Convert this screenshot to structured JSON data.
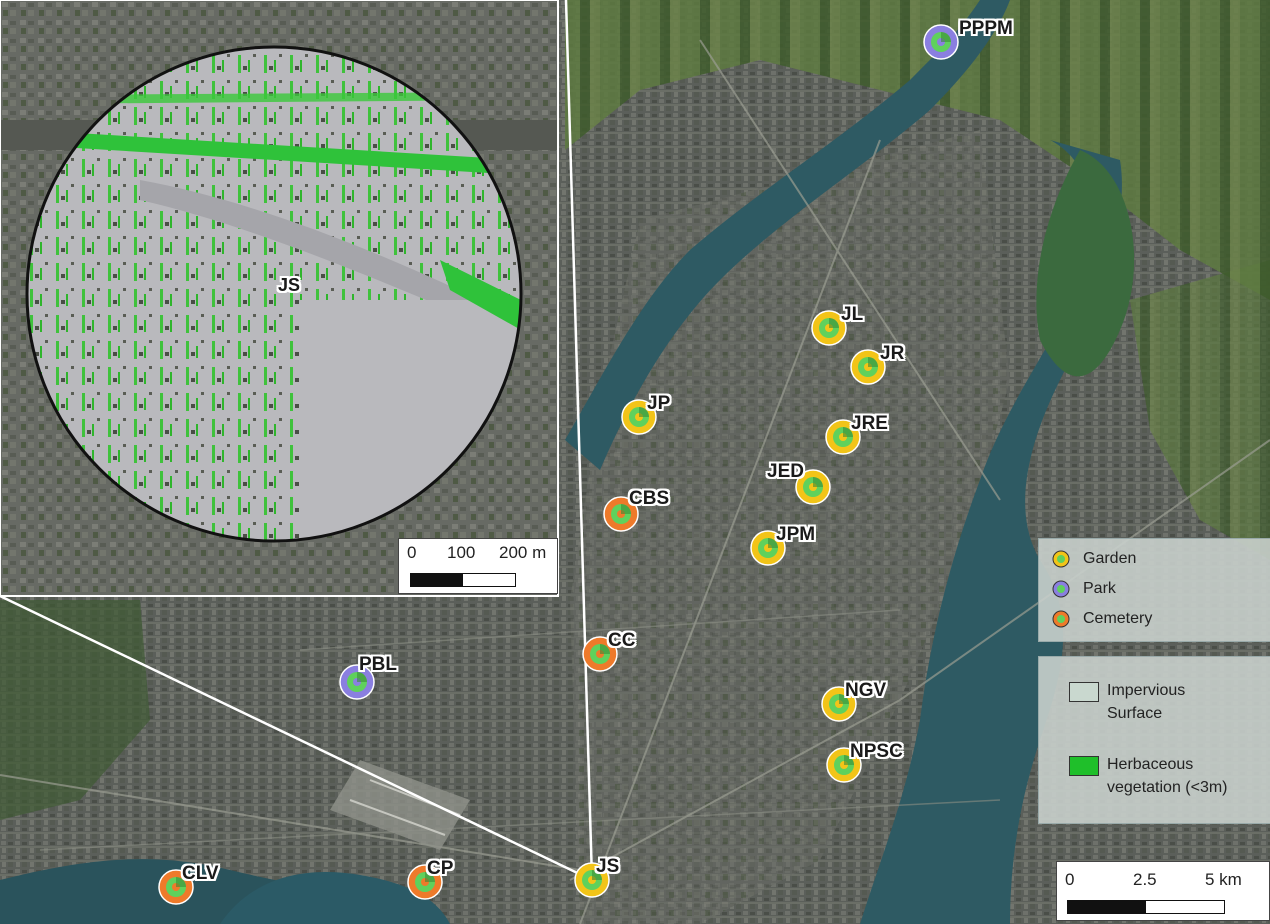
{
  "sites": [
    {
      "code": "PPPM",
      "type": "park"
    },
    {
      "code": "JL",
      "type": "garden"
    },
    {
      "code": "JR",
      "type": "garden"
    },
    {
      "code": "JP",
      "type": "garden"
    },
    {
      "code": "JRE",
      "type": "garden"
    },
    {
      "code": "JED",
      "type": "garden"
    },
    {
      "code": "CBS",
      "type": "cemetery"
    },
    {
      "code": "JPM",
      "type": "garden"
    },
    {
      "code": "CC",
      "type": "cemetery"
    },
    {
      "code": "PBL",
      "type": "park"
    },
    {
      "code": "NGV",
      "type": "garden"
    },
    {
      "code": "NPSC",
      "type": "garden"
    },
    {
      "code": "CLV",
      "type": "cemetery"
    },
    {
      "code": "CP",
      "type": "cemetery"
    },
    {
      "code": "JS",
      "type": "garden"
    }
  ],
  "inset": {
    "site_label": "JS",
    "scalebar": {
      "labels": [
        "0",
        "100",
        "200 m"
      ]
    }
  },
  "main_scalebar": {
    "labels": [
      "0",
      "2.5",
      "5 km"
    ]
  },
  "legend_site_types": {
    "garden": "Garden",
    "park": "Park",
    "cemetery": "Cemetery"
  },
  "legend_land_cover": {
    "impervious": "Impervious Surface",
    "impervious_line1": "Impervious",
    "impervious_line2": "Surface",
    "herbaceous_line1": "Herbaceous",
    "herbaceous_line2": "vegetation (<3m)"
  },
  "colors": {
    "garden": "#f2c418",
    "park": "#8a7fe0",
    "cemetery": "#ee7a2a",
    "site_green": "#5fd15c",
    "impervious": "#c9d8cf",
    "herbaceous": "#1fbf2a",
    "inset_gray": "#b9b9bd",
    "water": "#2e5a63"
  }
}
